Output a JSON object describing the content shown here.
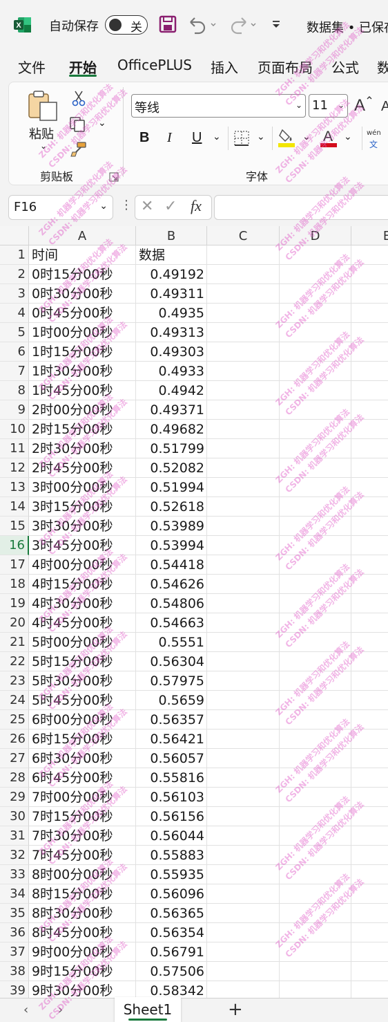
{
  "titlebar": {
    "autosave_label": "自动保存",
    "autosave_state": "关",
    "doc_title": "数据集 • 已保存"
  },
  "menu": {
    "items": [
      "文件",
      "开始",
      "OfficePLUS",
      "插入",
      "页面布局",
      "公式",
      "数"
    ],
    "active": "开始"
  },
  "ribbon": {
    "clipboard": {
      "paste_label": "粘贴",
      "group_label": "剪贴板"
    },
    "font": {
      "font_name": "等线",
      "font_size": "11",
      "group_label": "字体",
      "bold": "B",
      "italic": "I",
      "underline": "U",
      "phonetic_top": "wén",
      "phonetic_bottom": "文",
      "font_color_letter": "A",
      "accent_color": "#d40d1c",
      "highlight_color": "#f2e600"
    }
  },
  "formula_bar": {
    "name_box": "F16",
    "fx": "fx",
    "formula": ""
  },
  "grid": {
    "columns": [
      "A",
      "B",
      "C",
      "D",
      "E"
    ],
    "active_row": 16,
    "header": {
      "a": "时间",
      "b": "数据"
    },
    "rows": [
      [
        "0时15分00秒",
        "0.49192"
      ],
      [
        "0时30分00秒",
        "0.49311"
      ],
      [
        "0时45分00秒",
        "0.4935"
      ],
      [
        "1时00分00秒",
        "0.49313"
      ],
      [
        "1时15分00秒",
        "0.49303"
      ],
      [
        "1时30分00秒",
        "0.4933"
      ],
      [
        "1时45分00秒",
        "0.4942"
      ],
      [
        "2时00分00秒",
        "0.49371"
      ],
      [
        "2时15分00秒",
        "0.49682"
      ],
      [
        "2时30分00秒",
        "0.51799"
      ],
      [
        "2时45分00秒",
        "0.52082"
      ],
      [
        "3时00分00秒",
        "0.51994"
      ],
      [
        "3时15分00秒",
        "0.52618"
      ],
      [
        "3时30分00秒",
        "0.53989"
      ],
      [
        "3时45分00秒",
        "0.53994"
      ],
      [
        "4时00分00秒",
        "0.54418"
      ],
      [
        "4时15分00秒",
        "0.54626"
      ],
      [
        "4时30分00秒",
        "0.54806"
      ],
      [
        "4时45分00秒",
        "0.54663"
      ],
      [
        "5时00分00秒",
        "0.5551"
      ],
      [
        "5时15分00秒",
        "0.56304"
      ],
      [
        "5时30分00秒",
        "0.57975"
      ],
      [
        "5时45分00秒",
        "0.5659"
      ],
      [
        "6时00分00秒",
        "0.56357"
      ],
      [
        "6时15分00秒",
        "0.56421"
      ],
      [
        "6时30分00秒",
        "0.56057"
      ],
      [
        "6时45分00秒",
        "0.55816"
      ],
      [
        "7时00分00秒",
        "0.56103"
      ],
      [
        "7时15分00秒",
        "0.56156"
      ],
      [
        "7时30分00秒",
        "0.56044"
      ],
      [
        "7时45分00秒",
        "0.55883"
      ],
      [
        "8时00分00秒",
        "0.55935"
      ],
      [
        "8时15分00秒",
        "0.56096"
      ],
      [
        "8时30分00秒",
        "0.56365"
      ],
      [
        "8时45分00秒",
        "0.56354"
      ],
      [
        "9时00分00秒",
        "0.56791"
      ],
      [
        "9时15分00秒",
        "0.57506"
      ],
      [
        "9时30分00秒",
        "0.58342"
      ]
    ]
  },
  "sheets": {
    "tabs": [
      "Sheet1"
    ],
    "add_label": "+"
  },
  "watermark": {
    "line1": "ZGH: 机器学习和优化算法",
    "line2": "CSDN: 机器学习和优化算法"
  }
}
